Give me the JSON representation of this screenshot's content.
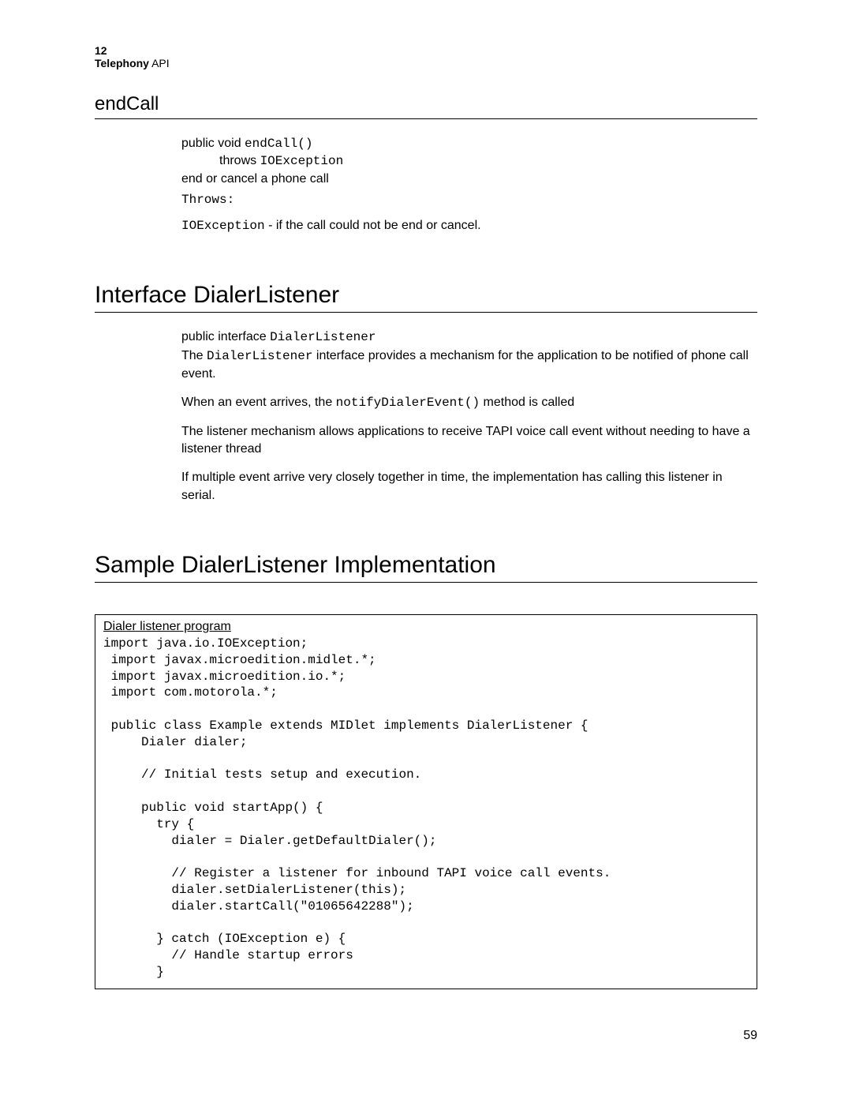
{
  "header": {
    "chapter_num": "12",
    "chapter_title_bold": "Telephony",
    "chapter_title_rest": " API"
  },
  "endcall": {
    "heading": "endCall",
    "sig_prefix": "public void ",
    "sig_method": "endCall()",
    "throws_kw": "throws ",
    "throws_type": "IOException",
    "desc": "end or cancel a phone call",
    "throws_label": "Throws:",
    "throws_item_type": "IOException",
    "throws_item_rest": " - if the call could not be end or cancel."
  },
  "dialer_listener": {
    "heading": "Interface DialerListener",
    "sig_prefix": "public interface ",
    "sig_name": "DialerListener",
    "para1_pre": "The ",
    "para1_code": "DialerListener",
    "para1_post": " interface provides a mechanism for the application to be notified of phone call event.",
    "para2_pre": "When an event arrives, the ",
    "para2_code": "notifyDialerEvent()",
    "para2_post": " method is called",
    "para3": "The listener mechanism allows applications to receive TAPI voice call event without needing to have a listener thread",
    "para4": "If multiple event arrive very closely together in time, the implementation has calling this listener in serial."
  },
  "sample": {
    "heading": "Sample DialerListener Implementation",
    "box_title": "Dialer listener program",
    "code": "import java.io.IOException;\n import javax.microedition.midlet.*;\n import javax.microedition.io.*;\n import com.motorola.*;\n\n public class Example extends MIDlet implements DialerListener {\n     Dialer dialer;\n\n     // Initial tests setup and execution.\n\n     public void startApp() {\n       try {\n         dialer = Dialer.getDefaultDialer();\n\n         // Register a listener for inbound TAPI voice call events.\n         dialer.setDialerListener(this);\n         dialer.startCall(\"01065642288\");\n\n       } catch (IOException e) {\n         // Handle startup errors\n       }"
  },
  "page_number": "59"
}
